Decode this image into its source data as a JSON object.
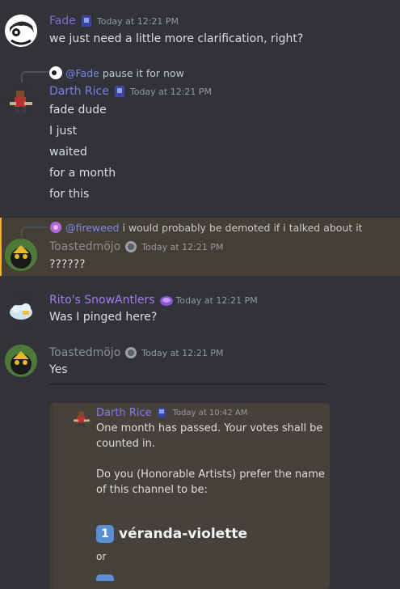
{
  "messages": [
    {
      "author": "Fade",
      "author_color": "#7f6de0",
      "timestamp": "Today at 12:21 PM",
      "lines": [
        "we just need a little more clarification, right?"
      ]
    },
    {
      "reply": {
        "mention": "@Fade",
        "text": "pause it for now"
      },
      "author": "Darth Rice",
      "author_color": "#7f7be8",
      "timestamp": "Today at 12:21 PM",
      "lines": [
        "fade dude",
        "I just",
        "waited",
        "for a month",
        "for this"
      ]
    },
    {
      "reply": {
        "mention": "@fireweed",
        "text": "i would probably be demoted if i talked about it"
      },
      "author": "Toastedmöjo",
      "author_color": "#8c8f93",
      "timestamp": "Today at 12:21 PM",
      "lines": [
        "??????"
      ]
    },
    {
      "author": "Rito's SnowAntlers",
      "author_color": "#a47cf0",
      "timestamp": "Today at 12:21 PM",
      "lines": [
        "Was I pinged here?"
      ]
    },
    {
      "author": "Toastedmöjo",
      "author_color": "#8c8f93",
      "timestamp": "Today at 12:21 PM",
      "lines": [
        "Yes"
      ]
    }
  ],
  "embed": {
    "author": "Darth Rice",
    "timestamp": "Today at 10:42 AM",
    "lines": [
      "One month has passed. Your votes shall be",
      "counted in.",
      "Do you (Honorable Artists) prefer the name",
      "of this channel to be:"
    ],
    "option1_key": "1",
    "option1": "véranda-violette",
    "or": "or"
  }
}
